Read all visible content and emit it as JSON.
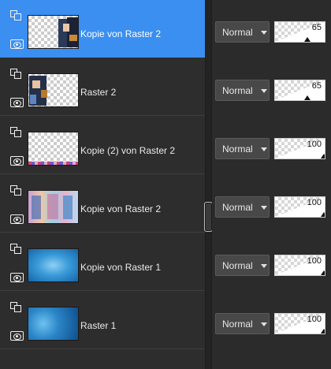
{
  "layers": [
    {
      "name": "Kopie von Raster 2",
      "selected": true,
      "blend_mode": "Normal",
      "opacity": "65",
      "opacity_fraction": 0.65
    },
    {
      "name": "Raster 2",
      "selected": false,
      "blend_mode": "Normal",
      "opacity": "65",
      "opacity_fraction": 0.65
    },
    {
      "name": "Kopie (2) von Raster 2",
      "selected": false,
      "blend_mode": "Normal",
      "opacity": "100",
      "opacity_fraction": 1.0
    },
    {
      "name": "Kopie von Raster 2",
      "selected": false,
      "blend_mode": "Normal",
      "opacity": "100",
      "opacity_fraction": 1.0
    },
    {
      "name": "Kopie von Raster 1",
      "selected": false,
      "blend_mode": "Normal",
      "opacity": "100",
      "opacity_fraction": 1.0
    },
    {
      "name": "Raster 1",
      "selected": false,
      "blend_mode": "Normal",
      "opacity": "100",
      "opacity_fraction": 1.0
    }
  ],
  "icons": {
    "group": "layer-group-icon",
    "visibility": "eye-icon",
    "dropdown": "chevron-down-icon"
  },
  "colors": {
    "selected_row": "#3a8ff1",
    "panel_bg": "#2d2d2d"
  }
}
